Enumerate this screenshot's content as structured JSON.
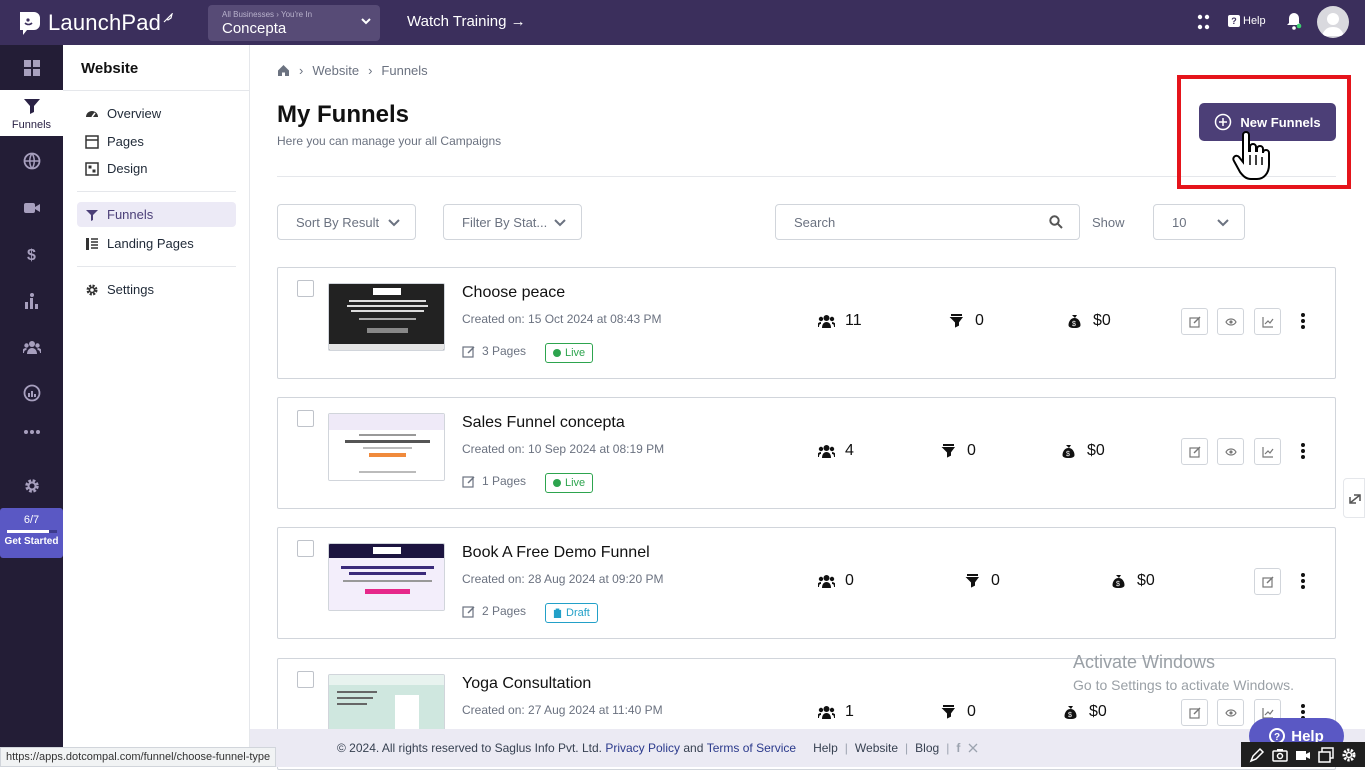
{
  "app": {
    "name": "LaunchPad"
  },
  "business": {
    "sub": "All Businesses › You're In",
    "name": "Concepta"
  },
  "topbar": {
    "watch_training": "Watch Training →",
    "help": "Help"
  },
  "rail": {
    "active_label": "Funnels",
    "progress": "6/7",
    "progress_fraction": 0.857,
    "get_started": "Get Started"
  },
  "subnav": {
    "title": "Website",
    "items": [
      {
        "label": "Overview",
        "icon": "dashboard-icon"
      },
      {
        "label": "Pages",
        "icon": "pages-icon"
      },
      {
        "label": "Design",
        "icon": "design-icon"
      },
      {
        "label": "Funnels",
        "icon": "funnel-icon"
      },
      {
        "label": "Landing Pages",
        "icon": "landing-pages-icon"
      },
      {
        "label": "Settings",
        "icon": "gear-icon"
      }
    ]
  },
  "breadcrumb": {
    "items": [
      "Website",
      "Funnels"
    ]
  },
  "page": {
    "title": "My Funnels",
    "subtitle": "Here you can manage your all Campaigns",
    "new_button": "New Funnels"
  },
  "filters": {
    "sort": "Sort By Result",
    "status": "Filter By Stat...",
    "search_placeholder": "Search",
    "show_label": "Show",
    "show_value": "10"
  },
  "funnels": [
    {
      "name": "Choose peace",
      "created": "Created on: 15 Oct 2024 at 08:43 PM",
      "pages": "3 Pages",
      "status": "Live",
      "visitors": "11",
      "conversions": "0",
      "revenue": "$0"
    },
    {
      "name": "Sales Funnel concepta",
      "created": "Created on: 10 Sep 2024 at 08:19 PM",
      "pages": "1 Pages",
      "status": "Live",
      "visitors": "4",
      "conversions": "0",
      "revenue": "$0"
    },
    {
      "name": "Book A Free Demo Funnel",
      "created": "Created on: 28 Aug 2024 at 09:20 PM",
      "pages": "2 Pages",
      "status": "Draft",
      "visitors": "0",
      "conversions": "0",
      "revenue": "$0"
    },
    {
      "name": "Yoga Consultation",
      "created": "Created on: 27 Aug 2024 at 11:40 PM",
      "pages": "",
      "status": "",
      "visitors": "1",
      "conversions": "0",
      "revenue": "$0"
    }
  ],
  "footer": {
    "copyright": "© 2024. All rights reserved to Saglus Info Pvt. Ltd.",
    "privacy": "Privacy Policy",
    "and": "and",
    "terms": "Terms of Service",
    "links": [
      "Help",
      "Website",
      "Blog"
    ]
  },
  "status_url": "https://apps.dotcompal.com/funnel/choose-funnel-type",
  "watermark": {
    "line1": "Activate Windows",
    "line2": "Go to Settings to activate Windows."
  },
  "help_fab": "Help",
  "colors": {
    "topbar": "#3b2f5c",
    "rail": "#231d36",
    "accent": "#4c3f77",
    "live": "#2da44e",
    "draft": "#22a0c8",
    "highlight": "#e5141b"
  }
}
